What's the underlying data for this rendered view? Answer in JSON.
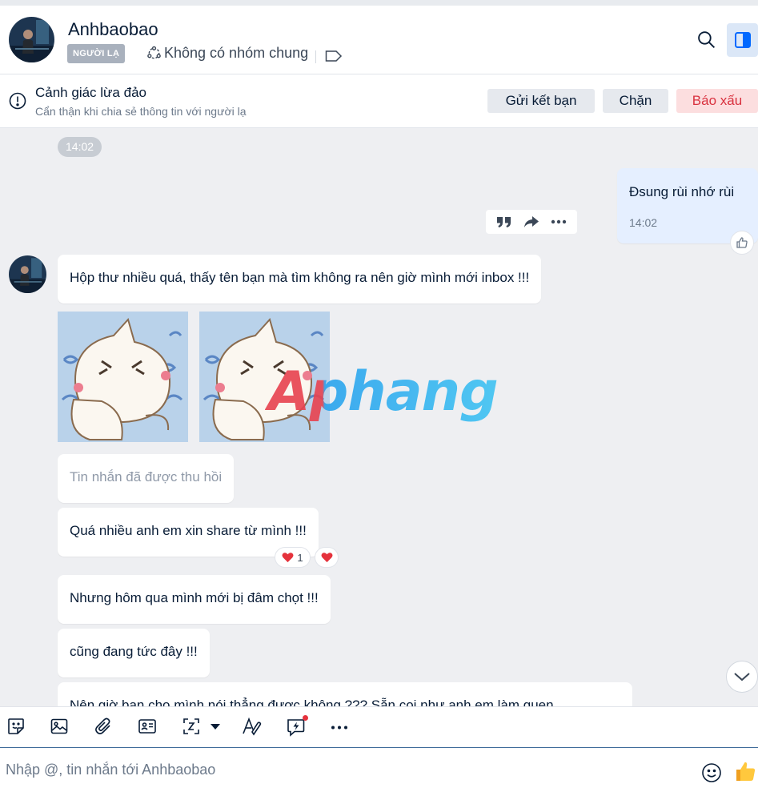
{
  "header": {
    "contact_name": "Anhbaobao",
    "stranger_badge": "NGƯỜI LẠ",
    "group_info": "Không có nhóm chung"
  },
  "warning": {
    "title": "Cảnh giác lừa đảo",
    "subtitle": "Cẩn thận khi chia sẻ thông tin với người lạ",
    "add_friend": "Gửi kết bạn",
    "block": "Chặn",
    "report": "Báo xấu"
  },
  "chat": {
    "time_pill": "14:02",
    "my_message": {
      "text": "Đsung rùi nhớ rùi",
      "time": "14:02"
    },
    "messages": [
      "Hộp thư nhiều quá, thấy tên bạn mà tìm không ra nên giờ mình mới inbox !!!",
      "Tin nhắn đã được thu hồi",
      "Quá nhiều anh em xin share từ mình !!!",
      "Nhưng hôm qua mình mới bị đâm chọt !!!",
      "cũng đang tức đây !!!",
      "Nên giờ bạn cho mình nói thẳng được không ??? Sẵn coi như anh em làm quen"
    ],
    "reaction_count": "1",
    "watermark": "Aphang"
  },
  "composer": {
    "placeholder": "Nhập @, tin nhắn tới Anhbaobao"
  },
  "colors": {
    "accent": "#0068ff",
    "danger": "#d9323f",
    "chat_bg": "#eeeff2",
    "my_bubble": "#e5efff"
  },
  "icons": [
    "search-icon",
    "sidebar-panel-icon",
    "alert-circle-icon",
    "quote-icon",
    "share-icon",
    "more-icon",
    "thumbs-up-icon",
    "heart-icon",
    "chevron-down-icon",
    "sticker-icon",
    "image-icon",
    "paperclip-icon",
    "contact-card-icon",
    "screenshot-icon",
    "text-format-icon",
    "quick-message-icon",
    "emoji-icon"
  ]
}
